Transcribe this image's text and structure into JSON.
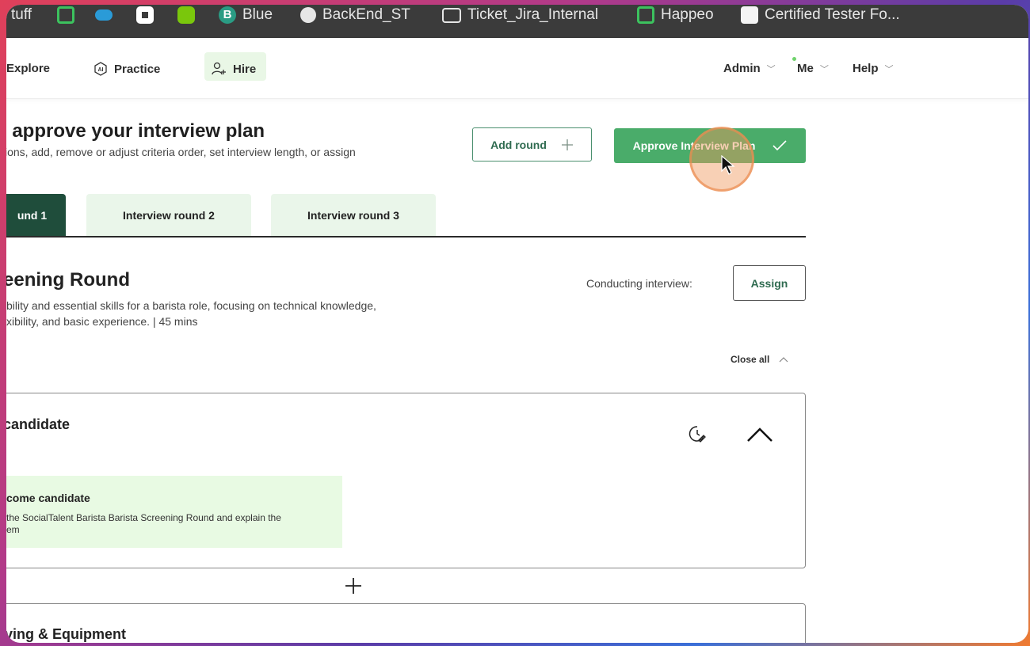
{
  "bookmarks": [
    {
      "label": "tuff",
      "icon": "none"
    },
    {
      "label": "",
      "icon": "chat-icon"
    },
    {
      "label": "",
      "icon": "salesforce-cloud-icon"
    },
    {
      "label": "",
      "icon": "app-square-icon"
    },
    {
      "label": "",
      "icon": "owl-icon"
    },
    {
      "label": "Blue",
      "icon": "b-letter-icon"
    },
    {
      "label": "BackEnd_ST",
      "icon": "globe-icon"
    },
    {
      "label": "Ticket_Jira_Internal",
      "icon": "folder-icon"
    },
    {
      "label": "Happeo",
      "icon": "chat-icon"
    },
    {
      "label": "Certified Tester Fo...",
      "icon": "certificate-icon"
    }
  ],
  "nav": {
    "explore": "Explore",
    "practice": "Practice",
    "practice_icon_text": "AI",
    "hire": "Hire",
    "admin": "Admin",
    "me": "Me",
    "help": "Help"
  },
  "plan": {
    "title": "l approve your interview plan",
    "subtitle": "ions, add, remove or adjust criteria order, set interview length, or assign",
    "add_round": "Add round",
    "approve": "Approve Interview Plan"
  },
  "tabs": [
    {
      "label": "und 1",
      "active": true
    },
    {
      "label": "Interview round 2",
      "active": false
    },
    {
      "label": "Interview round 3",
      "active": false
    }
  ],
  "round": {
    "title": "eening Round",
    "desc_line1": "bility and essential skills for a barista role, focusing on technical knowledge,",
    "desc_line2": "xibility, and basic experience.  |  45 mins",
    "conducting_label": "Conducting interview:",
    "assign": "Assign",
    "close_all": "Close all"
  },
  "section1": {
    "title": "candidate",
    "question_title": "come candidate",
    "question_line1": "the SocialTalent Barista Barista Screening Round and explain the",
    "question_line2": "em"
  },
  "section2": {
    "title": "ving & Equipment"
  },
  "colors": {
    "accent_green": "#4aac6a",
    "dark_green": "#1f4d3b",
    "light_green": "#e8fae3"
  }
}
